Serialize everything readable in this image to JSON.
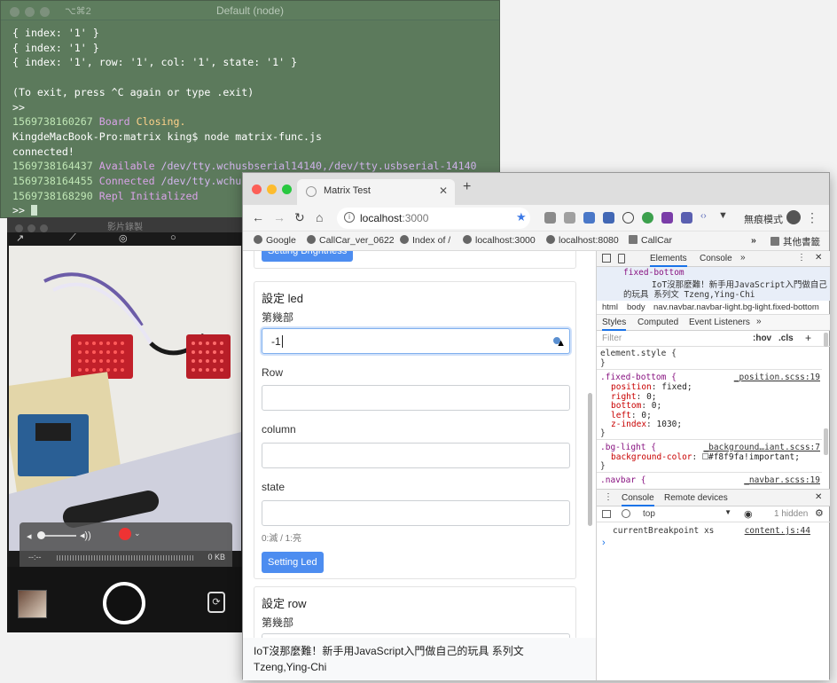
{
  "terminal": {
    "shortcut": "⌥⌘2",
    "title": "Default (node)",
    "lines": [
      "{ index: '1' }",
      "{ index: '1' }",
      "{ index: '1', row: '1', col: '1', state: '1' }",
      "",
      "(To exit, press ^C again or type .exit)",
      ">>"
    ],
    "log1_ts": "1569738160267",
    "log1_a": "Board",
    "log1_b": "Closing.",
    "prompt": "KingdeMacBook-Pro:matrix king$ node matrix-func.js",
    "connected": "connected!",
    "log2_ts": "1569738164437",
    "log2_a": "Available",
    "log2_b": "/dev/tty.wchusbserial14140,/dev/tty.usbserial-14140",
    "log3_ts": "1569738164455",
    "log3_a": "Connected",
    "log3_b": "/dev/tty.wchusbserial14140",
    "log4_ts": "1569738168290",
    "log4_a": "Repl",
    "log4_b": "Initialized",
    "last_prompt": ">>"
  },
  "camera": {
    "title": "影片錄製",
    "size": "0 KB",
    "time": "--:--"
  },
  "browser": {
    "tab_title": "Matrix Test",
    "url_host": "localhost",
    "url_port": ":3000",
    "incognito": "無痕模式",
    "bookmarks": [
      "Google",
      "CallCar_ver_0622",
      "Index of /",
      "localhost:3000",
      "localhost:8080",
      "CallCar"
    ],
    "other_bookmarks": "其他書籤",
    "more": "»"
  },
  "page": {
    "btn_brightness": "Setting Brightness",
    "section_led": "設定 led",
    "label_which": "第幾部",
    "input_which_value": "-1",
    "label_row": "Row",
    "label_column": "column",
    "label_state": "state",
    "state_hint": "0:滅 / 1:亮",
    "btn_led": "Setting Led",
    "section_row": "設定 row",
    "label_which2": "第幾部",
    "footer_line1": "IoT沒那麼難！新手用JavaScript入門做自己的玩具 系列文",
    "footer_line2": "Tzeng,Ying-Chi"
  },
  "devtools": {
    "tabs": [
      "Elements",
      "Console"
    ],
    "crumb_top": "fixed-bottom",
    "crumb_text1": "IoT沒那麼難！新手用JavaScript入門做自己",
    "crumb_text2": "的玩具 系列文  Tzeng,Ying-Chi",
    "path": [
      "html",
      "body",
      "nav.navbar.navbar-light.bg-light.fixed-bottom"
    ],
    "style_tabs": [
      "Styles",
      "Computed",
      "Event Listeners"
    ],
    "filter": "Filter",
    "hov": ":hov",
    "cls": ".cls",
    "element_style": "element.style {",
    "rule1_sel": ".fixed-bottom {",
    "rule1_src": "_position.scss:19",
    "rule1_props": [
      {
        "p": "position",
        "v": "fixed;"
      },
      {
        "p": "right",
        "v": "0;"
      },
      {
        "p": "bottom",
        "v": "0;"
      },
      {
        "p": "left",
        "v": "0;"
      },
      {
        "p": "z-index",
        "v": "1030;"
      }
    ],
    "rule2_sel": ".bg-light {",
    "rule2_src": "_background…iant.scss:7",
    "rule2_prop": "background-color",
    "rule2_val": "#f8f9fa!important;",
    "rule3_sel": ".navbar {",
    "rule3_src": "_navbar.scss:19",
    "drawer_tabs": [
      "Console",
      "Remote devices"
    ],
    "context": "top",
    "hidden": "1 hidden",
    "console_msg": "currentBreakpoint xs",
    "console_src": "content.js:44",
    "close_brace": "}"
  },
  "colors": {
    "accent": "#4d8df0",
    "terminal_bg": "#5c7a5c"
  }
}
